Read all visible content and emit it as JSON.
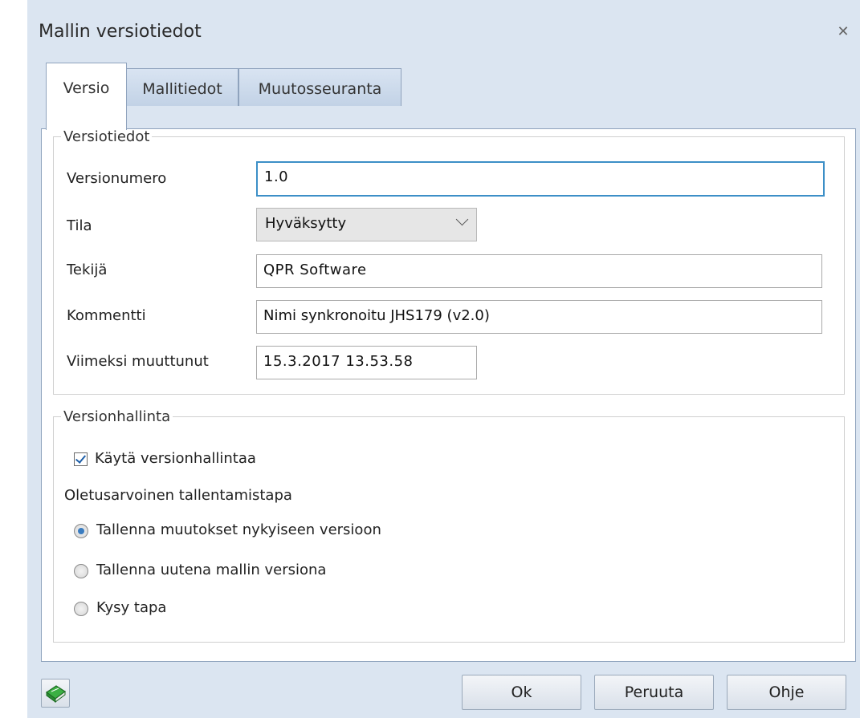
{
  "window": {
    "title": "Mallin versiotiedot",
    "close_glyph": "✕"
  },
  "tabs": [
    {
      "label": "Versio",
      "active": true
    },
    {
      "label": "Mallitiedot",
      "active": false
    },
    {
      "label": "Muutosseuranta",
      "active": false
    }
  ],
  "version_info": {
    "legend": "Versiotiedot",
    "version_number": {
      "label": "Versionumero",
      "value": "1.0"
    },
    "state": {
      "label": "Tila",
      "value": "Hyväksytty"
    },
    "author": {
      "label": "Tekijä",
      "value": "QPR Software"
    },
    "comment": {
      "label": "Kommentti",
      "value": "Nimi synkronoitu JHS179 (v2.0)"
    },
    "last_modified": {
      "label": "Viimeksi muuttunut",
      "value": "15.3.2017 13.53.58"
    }
  },
  "version_control": {
    "legend": "Versionhallinta",
    "use_checkbox": {
      "label": "Käytä versionhallintaa",
      "checked": true
    },
    "default_save_heading": "Oletusarvoinen tallentamistapa",
    "options": [
      {
        "label": "Tallenna muutokset nykyiseen versioon",
        "selected": true
      },
      {
        "label": "Tallenna uutena mallin versiona",
        "selected": false
      },
      {
        "label": "Kysy tapa",
        "selected": false
      }
    ]
  },
  "footer": {
    "help_book_icon": "green-book-icon",
    "ok": "Ok",
    "cancel": "Peruuta",
    "help": "Ohje"
  },
  "colors": {
    "frame": "#dbe5f1",
    "focus_border": "#3c8fc7",
    "tab_inactive": "#c2d2e6"
  }
}
